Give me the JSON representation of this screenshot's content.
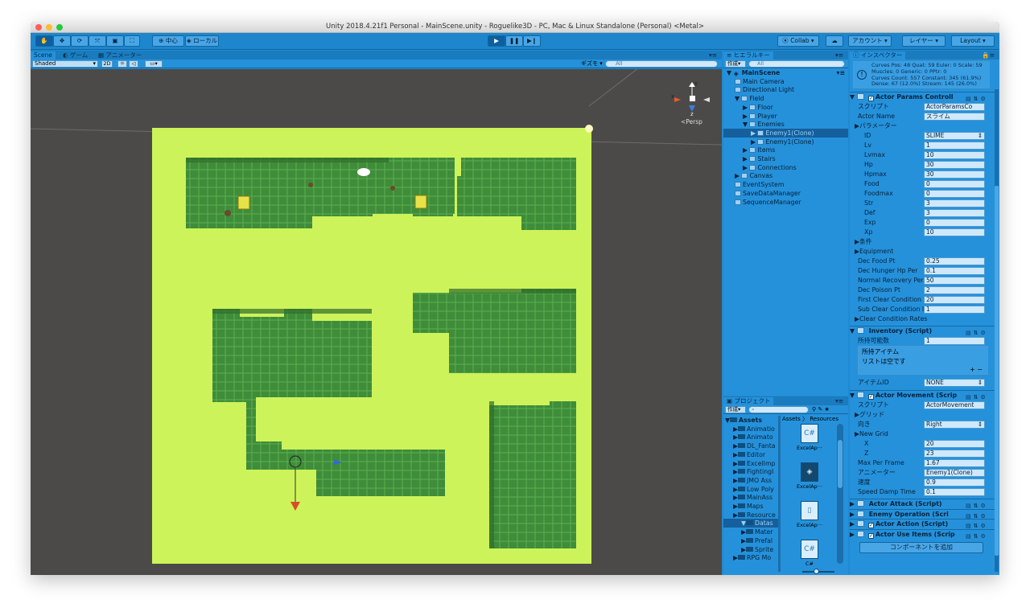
{
  "window": {
    "title": "Unity 2018.4.21f1 Personal - MainScene.unity - Roguelike3D - PC, Mac & Linux Standalone (Personal) <Metal>"
  },
  "toolbar": {
    "pivot": "中心",
    "space": "ローカル",
    "collab": "Collab",
    "account": "アカウント",
    "layers": "レイヤー",
    "layout": "Layout"
  },
  "scene": {
    "tabs": [
      "Scene",
      "ゲーム",
      "アニメーター"
    ],
    "shading": "Shaded",
    "mode_2d": "2D",
    "gizmos": "ギズモ",
    "search_placeholder": "All",
    "persp": "Persp",
    "gizmo_axes": {
      "x": "x",
      "y": "y",
      "z": "z"
    }
  },
  "hierarchy": {
    "tab": "ヒエラルキー",
    "create": "作成",
    "search_placeholder": "All",
    "items": [
      {
        "label": "MainScene",
        "depth": 0,
        "expanded": true,
        "bold": true
      },
      {
        "label": "Main Camera",
        "depth": 1
      },
      {
        "label": "Directional Light",
        "depth": 1
      },
      {
        "label": "Field",
        "depth": 1,
        "expanded": true
      },
      {
        "label": "Floor",
        "depth": 2,
        "collapsed": true
      },
      {
        "label": "Player",
        "depth": 2,
        "collapsed": true
      },
      {
        "label": "Enemies",
        "depth": 2,
        "expanded": true
      },
      {
        "label": "Enemy1(Clone)",
        "depth": 3,
        "collapsed": true,
        "selected": true
      },
      {
        "label": "Enemy1(Clone)",
        "depth": 3,
        "collapsed": true
      },
      {
        "label": "Items",
        "depth": 2,
        "collapsed": true
      },
      {
        "label": "Stairs",
        "depth": 2,
        "collapsed": true
      },
      {
        "label": "Connections",
        "depth": 2,
        "collapsed": true
      },
      {
        "label": "Canvas",
        "depth": 1,
        "collapsed": true
      },
      {
        "label": "EventSystem",
        "depth": 1
      },
      {
        "label": "SaveDataManager",
        "depth": 1
      },
      {
        "label": "SequenceManager",
        "depth": 1
      }
    ]
  },
  "project": {
    "tab": "プロジェクト",
    "create": "作成",
    "breadcrumb": [
      "Assets",
      "Resources"
    ],
    "folders": [
      {
        "label": "Assets",
        "depth": 0,
        "bold": true
      },
      {
        "label": "Animatio",
        "depth": 1
      },
      {
        "label": "Animato",
        "depth": 1
      },
      {
        "label": "DL_Fanta",
        "depth": 1
      },
      {
        "label": "Editor",
        "depth": 1
      },
      {
        "label": "ExcelImp",
        "depth": 1
      },
      {
        "label": "Fightingl",
        "depth": 1
      },
      {
        "label": "JMO Ass",
        "depth": 1
      },
      {
        "label": "Low Poly",
        "depth": 1
      },
      {
        "label": "MainAss",
        "depth": 1
      },
      {
        "label": "Maps",
        "depth": 1
      },
      {
        "label": "Resource",
        "depth": 1
      },
      {
        "label": "Datas",
        "depth": 2,
        "selected": true
      },
      {
        "label": "Mater",
        "depth": 2
      },
      {
        "label": "Prefal",
        "depth": 2
      },
      {
        "label": "Sprite",
        "depth": 2
      },
      {
        "label": "RPG Mo",
        "depth": 1
      }
    ],
    "assets": [
      {
        "label": "ExcelAp···",
        "icon": "C#"
      },
      {
        "label": "ExcelAp···",
        "icon": "unity-icon"
      },
      {
        "label": "ExcelAp···",
        "icon": "file-icon"
      },
      {
        "label": "C#",
        "icon": "C#"
      }
    ]
  },
  "inspector": {
    "tab": "インスペクター",
    "info": [
      "Curves Pos: 48 Quat: 59 Euler: 0 Scale: 59",
      "Muscles: 0 Generic: 0 PPtr: 0",
      "Curves Count: 557 Constant: 345 (61.9%)",
      "Dense: 67 (12.0%) Stream: 145 (26.0%)"
    ],
    "actor_params": {
      "title": "Actor Params Controll",
      "script_label": "スクリプト",
      "script_value": "ActorParamsCo",
      "fields": [
        {
          "label": "Actor Name",
          "value": "スライム",
          "indent": 0
        },
        {
          "label": "パラメーター",
          "value": "",
          "indent": 0,
          "fold": true
        },
        {
          "label": "ID",
          "value": "SLIME",
          "indent": 1,
          "dropdown": true
        },
        {
          "label": "Lv",
          "value": "1",
          "indent": 1
        },
        {
          "label": "Lvmax",
          "value": "10",
          "indent": 1
        },
        {
          "label": "Hp",
          "value": "30",
          "indent": 1
        },
        {
          "label": "Hpmax",
          "value": "30",
          "indent": 1
        },
        {
          "label": "Food",
          "value": "0",
          "indent": 1
        },
        {
          "label": "Foodmax",
          "value": "0",
          "indent": 1
        },
        {
          "label": "Str",
          "value": "3",
          "indent": 1
        },
        {
          "label": "Def",
          "value": "3",
          "indent": 1
        },
        {
          "label": "Exp",
          "value": "0",
          "indent": 1
        },
        {
          "label": "Xp",
          "value": "10",
          "indent": 1
        },
        {
          "label": "条件",
          "value": "",
          "indent": 0,
          "fold": true
        },
        {
          "label": "Equipment",
          "value": "",
          "indent": 0,
          "fold": true
        },
        {
          "label": "Dec Food Pt",
          "value": "0.25",
          "indent": 0
        },
        {
          "label": "Dec Hunger Hp Per",
          "value": "0.1",
          "indent": 0
        },
        {
          "label": "Normal Recovery Per",
          "value": "50",
          "indent": 0
        },
        {
          "label": "Dec Poison Pt",
          "value": "2",
          "indent": 0
        },
        {
          "label": "First Clear Condition",
          "value": "20",
          "indent": 0
        },
        {
          "label": "Sub Clear Condition I",
          "value": "1",
          "indent": 0
        },
        {
          "label": "Clear Condition Rates",
          "value": "",
          "indent": 0,
          "fold": true
        }
      ]
    },
    "inventory": {
      "title": "Inventory (Script)",
      "capacity_label": "所持可能数",
      "capacity_value": "1",
      "items_label": "所持アイテム",
      "empty_text": "リストは空です",
      "item_id_label": "アイテムID",
      "item_id_value": "NONE"
    },
    "movement": {
      "title": "Actor Movement (Scrip",
      "script_label": "スクリプト",
      "script_value": "ActorMovement",
      "fields": [
        {
          "label": "グリッド",
          "value": "",
          "indent": 0,
          "fold": true
        },
        {
          "label": "向き",
          "value": "Right",
          "indent": 0,
          "dropdown": true
        },
        {
          "label": "New Grid",
          "value": "",
          "indent": 0,
          "fold": true
        },
        {
          "label": "X",
          "value": "20",
          "indent": 1
        },
        {
          "label": "Z",
          "value": "23",
          "indent": 1
        },
        {
          "label": "Max Per Frame",
          "value": "1.67",
          "indent": 0
        },
        {
          "label": "アニメーター",
          "value": "Enemy1(Clone)",
          "indent": 0
        },
        {
          "label": "速度",
          "value": "0.9",
          "indent": 0
        },
        {
          "label": "Speed Damp Time",
          "value": "0.1",
          "indent": 0
        }
      ]
    },
    "collapsed": [
      {
        "title": "Actor Attack (Script)",
        "checked": false
      },
      {
        "title": "Enemy Operation (Scri",
        "checked": false
      },
      {
        "title": "Actor Action (Script)",
        "checked": true
      },
      {
        "title": "Actor Use Items (Scrip",
        "checked": true
      }
    ],
    "add_component": "コンポーネントを追加"
  },
  "colors": {
    "accent": "#1f8ad1",
    "floor_top": "#cdf35a",
    "pit": "#3f8c3a",
    "grid_line": "#5bb04d",
    "background": "#4b4a48"
  }
}
